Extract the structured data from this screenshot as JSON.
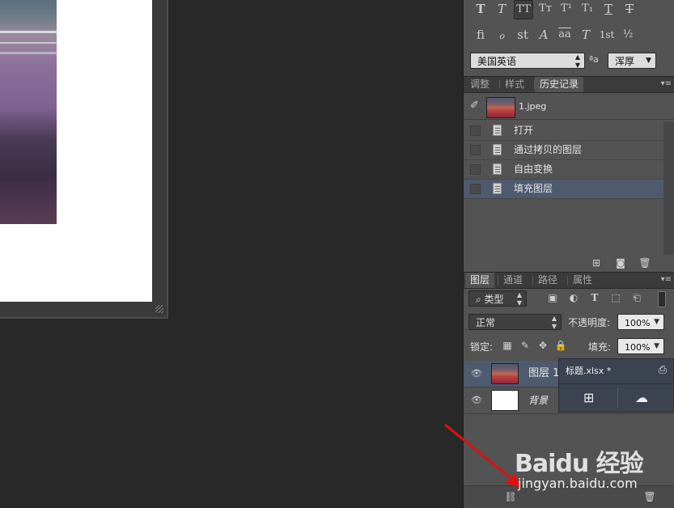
{
  "character_panel": {
    "style_glyphs_row1": [
      "T",
      "T",
      "TT",
      "Tт",
      "T¹",
      "T₁",
      "T",
      "T"
    ],
    "style_glyphs_row2": [
      "fi",
      "ℴ",
      "st",
      "A",
      "aa",
      "T",
      "1st",
      "½"
    ],
    "language": "美国英语",
    "aa_label": "ªa",
    "antialias": "浑厚"
  },
  "history_panel": {
    "tabs": [
      "调整",
      "样式",
      "历史记录"
    ],
    "active_tab": "历史记录",
    "snapshot_name": "1.jpeg",
    "items": [
      {
        "label": "打开",
        "selected": false
      },
      {
        "label": "通过拷贝的图层",
        "selected": false
      },
      {
        "label": "自由变换",
        "selected": false
      },
      {
        "label": "填充图层",
        "selected": true
      }
    ]
  },
  "layers_panel": {
    "tabs": [
      "图层",
      "通道",
      "路径",
      "属性"
    ],
    "active_tab": "图层",
    "filter_kind": "类型",
    "blend_mode": "正常",
    "opacity_label": "不透明度:",
    "opacity_value": "100%",
    "lock_label": "锁定:",
    "fill_label": "填充:",
    "fill_value": "100%",
    "layers": [
      {
        "name": "图层 1",
        "selected": true,
        "thumb": "photo"
      },
      {
        "name": "背景",
        "selected": false,
        "thumb": "white"
      }
    ]
  },
  "popup": {
    "title": "标题.xlsx *"
  },
  "watermark": {
    "brand": "Baidu 经验",
    "url": "jingyan.baidu.com"
  },
  "colors": {
    "panel_bg": "#535353",
    "canvas_bg": "#282828",
    "selection": "#4e5a6e",
    "annotation_arrow": "#e01010"
  }
}
